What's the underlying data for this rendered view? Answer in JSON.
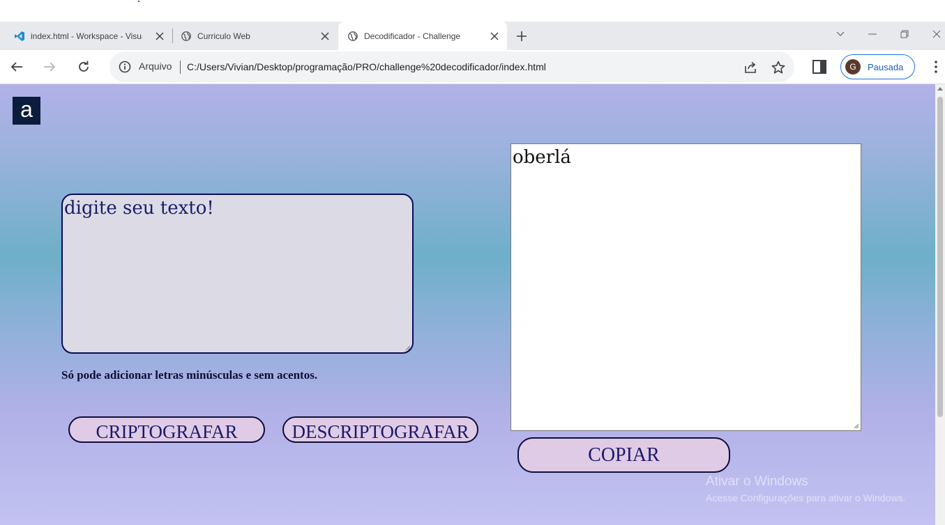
{
  "browser": {
    "tabs": [
      {
        "title": "index.html - Workspace - Visual Studio Code",
        "icon": "vscode-icon"
      },
      {
        "title": "Curriculo Web",
        "icon": "globe-icon"
      },
      {
        "title": "Decodificador - Challenge",
        "icon": "globe-icon",
        "active": true
      }
    ],
    "address": {
      "security_label": "Arquivo",
      "url": "C:/Users/Vivian/Desktop/programação/PRO/challenge%20decodificador/index.html"
    },
    "profile": {
      "initial": "G",
      "label": "Pausada"
    }
  },
  "page": {
    "logo_letter": "a",
    "input_placeholder": "digite seu texto!",
    "hint": "Só pode adicionar letras minúsculas e sem acentos.",
    "encrypt_label": "CRIPTOGRAFAR",
    "decrypt_label": "DESCRIPTOGRAFAR",
    "output_text": "oberlá",
    "copy_label": "COPIAR"
  },
  "watermark": {
    "line1": "Ativar o Windows",
    "line2": "Acesse Configurações para ativar o Windows."
  },
  "colors": {
    "accent": "#1a73e8",
    "button_fill": "#e0cbe6",
    "text_dark": "#1b1b6b"
  }
}
